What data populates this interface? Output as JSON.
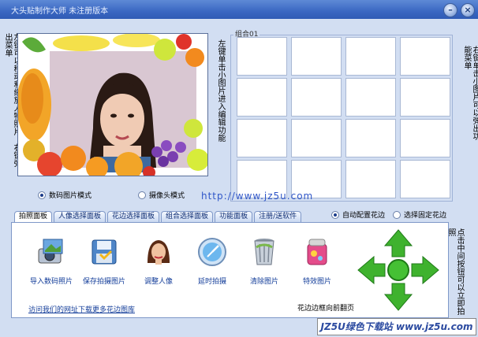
{
  "window": {
    "title": "大头贴制作大师   未注册版本"
  },
  "titlebar": {
    "minimize": "–",
    "close": "×"
  },
  "left_hint": "左键可以移动和缩放人物照片，右键弹出菜单",
  "middle_hint": "左键单击小图片进入编辑功能",
  "right_hint": "右键单击小图片可以弹出功能菜单",
  "group": {
    "label": "组合01"
  },
  "mode": {
    "options": [
      "数码图片模式",
      "摄像头模式"
    ],
    "selected": "数码图片模式"
  },
  "watermark_url": "http://www.jz5u.com",
  "tabs": [
    "拍照面板",
    "人像选择面板",
    "花边选择面板",
    "组合选择面板",
    "功能面板",
    "注册/送软件"
  ],
  "active_tab": "拍照面板",
  "frame_option": {
    "options": [
      "自动配置花边",
      "选择固定花边"
    ],
    "selected": "自动配置花边"
  },
  "tools": [
    {
      "label": "导入数码照片",
      "icon": "camera-icon"
    },
    {
      "label": "保存拍摄图片",
      "icon": "floppy-disk-icon"
    },
    {
      "label": "调整人像",
      "icon": "portrait-icon"
    },
    {
      "label": "延时拍摄",
      "icon": "timer-icon"
    },
    {
      "label": "清除图片",
      "icon": "trash-icon"
    },
    {
      "label": "特效图片",
      "icon": "effects-icon"
    }
  ],
  "visit_link": "访问我们的网址下载更多花边图库",
  "frame_note": "花边边框向前翻页",
  "nav_hint": "点击中间按钮可以立即拍照",
  "footer_brand": "JZ5U绿色下载站 www.jz5u.com"
}
